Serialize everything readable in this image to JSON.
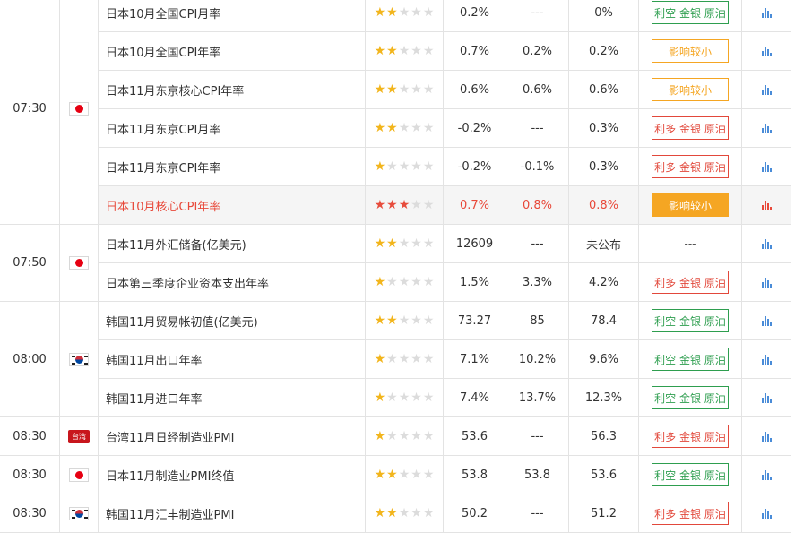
{
  "groups": [
    {
      "time": "07:30",
      "flag": "jp",
      "rows": 6
    },
    {
      "time": "07:50",
      "flag": "jp",
      "rows": 2
    },
    {
      "time": "08:00",
      "flag": "kr",
      "rows": 3
    },
    {
      "time": "08:30",
      "flag": "tw",
      "flag_text": "台湾",
      "rows": 1
    },
    {
      "time": "08:30",
      "flag": "jp",
      "rows": 1
    },
    {
      "time": "08:30",
      "flag": "kr",
      "rows": 1
    }
  ],
  "rows": [
    {
      "name": "日本10月全国CPI月率",
      "stars": 2,
      "prev": "0.2%",
      "forecast": "---",
      "actual": "0%",
      "effect": "利空 金银 原油",
      "effect_style": "green",
      "highlight": false
    },
    {
      "name": "日本10月全国CPI年率",
      "stars": 2,
      "prev": "0.7%",
      "forecast": "0.2%",
      "actual": "0.2%",
      "effect": "影响较小",
      "effect_style": "orange",
      "highlight": false
    },
    {
      "name": "日本11月东京核心CPI年率",
      "stars": 2,
      "prev": "0.6%",
      "forecast": "0.6%",
      "actual": "0.6%",
      "effect": "影响较小",
      "effect_style": "orange",
      "highlight": false
    },
    {
      "name": "日本11月东京CPI月率",
      "stars": 2,
      "prev": "-0.2%",
      "forecast": "---",
      "actual": "0.3%",
      "effect": "利多 金银 原油",
      "effect_style": "red",
      "highlight": false
    },
    {
      "name": "日本11月东京CPI年率",
      "stars": 1,
      "prev": "-0.2%",
      "forecast": "-0.1%",
      "actual": "0.3%",
      "effect": "利多 金银 原油",
      "effect_style": "red",
      "highlight": false
    },
    {
      "name": "日本10月核心CPI年率",
      "stars": 3,
      "prev": "0.7%",
      "forecast": "0.8%",
      "actual": "0.8%",
      "effect": "影响较小",
      "effect_style": "solid-orange",
      "highlight": true
    },
    {
      "name": "日本11月外汇储备(亿美元)",
      "stars": 2,
      "prev": "12609",
      "forecast": "---",
      "actual": "未公布",
      "effect": "---",
      "effect_style": "none",
      "highlight": false
    },
    {
      "name": "日本第三季度企业资本支出年率",
      "stars": 1,
      "prev": "1.5%",
      "forecast": "3.3%",
      "actual": "4.2%",
      "effect": "利多 金银 原油",
      "effect_style": "red",
      "highlight": false
    },
    {
      "name": "韩国11月贸易帐初值(亿美元)",
      "stars": 2,
      "prev": "73.27",
      "forecast": "85",
      "actual": "78.4",
      "effect": "利空 金银 原油",
      "effect_style": "green",
      "highlight": false
    },
    {
      "name": "韩国11月出口年率",
      "stars": 1,
      "prev": "7.1%",
      "forecast": "10.2%",
      "actual": "9.6%",
      "effect": "利空 金银 原油",
      "effect_style": "green",
      "highlight": false
    },
    {
      "name": "韩国11月进口年率",
      "stars": 1,
      "prev": "7.4%",
      "forecast": "13.7%",
      "actual": "12.3%",
      "effect": "利空 金银 原油",
      "effect_style": "green",
      "highlight": false
    },
    {
      "name": "台湾11月日经制造业PMI",
      "stars": 1,
      "prev": "53.6",
      "forecast": "---",
      "actual": "56.3",
      "effect": "利多 金银 原油",
      "effect_style": "red",
      "highlight": false
    },
    {
      "name": "日本11月制造业PMI终值",
      "stars": 2,
      "prev": "53.8",
      "forecast": "53.8",
      "actual": "53.6",
      "effect": "利空 金银 原油",
      "effect_style": "green",
      "highlight": false
    },
    {
      "name": "韩国11月汇丰制造业PMI",
      "stars": 2,
      "prev": "50.2",
      "forecast": "---",
      "actual": "51.2",
      "effect": "利多 金银 原油",
      "effect_style": "red",
      "highlight": false
    }
  ]
}
